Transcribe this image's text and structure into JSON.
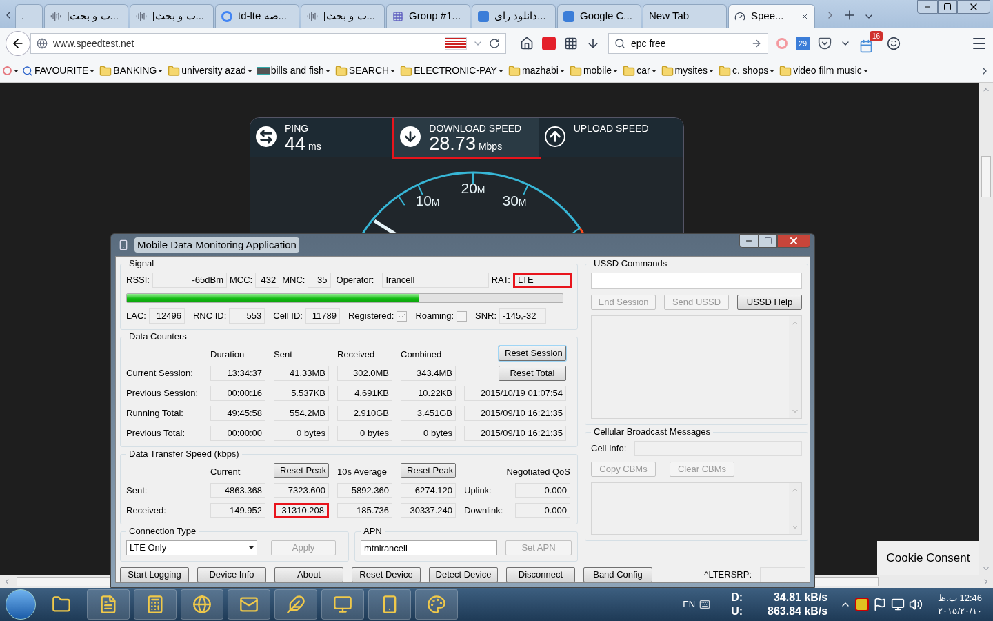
{
  "browser": {
    "tabs": [
      {
        "label": ".",
        "kind": "none",
        "selected": false
      },
      {
        "label": "[ب و بحث...",
        "kind": "audio",
        "selected": false
      },
      {
        "label": "[ب و بحث...",
        "kind": "audio",
        "selected": false
      },
      {
        "label": "td-lte صه...",
        "kind": "g",
        "selected": false
      },
      {
        "label": "[ب و بحث...",
        "kind": "audio",
        "selected": false
      },
      {
        "label": "Group #1...",
        "kind": "grid",
        "selected": false
      },
      {
        "label": "دانلود رای...",
        "kind": "s",
        "selected": false
      },
      {
        "label": "Google C...",
        "kind": "s",
        "selected": false
      },
      {
        "label": "New Tab",
        "kind": "none",
        "selected": false
      },
      {
        "label": "Spee...",
        "kind": "gauge",
        "selected": true
      }
    ],
    "url": "www.speedtest.net",
    "search": "epc free",
    "calendar_day": "29",
    "notification_count": "16",
    "bookmarks": [
      {
        "label": "FAVOURITE",
        "kind": "search"
      },
      {
        "label": "BANKING",
        "kind": "folder"
      },
      {
        "label": "university azad",
        "kind": "folder"
      },
      {
        "label": "bills and fish",
        "kind": "card"
      },
      {
        "label": "SEARCH",
        "kind": "folder"
      },
      {
        "label": "ELECTRONIC-PAY",
        "kind": "folder"
      },
      {
        "label": "mazhabi",
        "kind": "folder"
      },
      {
        "label": "mobile",
        "kind": "folder"
      },
      {
        "label": "car",
        "kind": "folder"
      },
      {
        "label": "mysites",
        "kind": "folder"
      },
      {
        "label": "c. shops",
        "kind": "folder"
      },
      {
        "label": "video film music",
        "kind": "folder"
      }
    ]
  },
  "speedtest": {
    "panels": [
      {
        "kind": "ping",
        "title": "PING",
        "value": "44",
        "unit": "ms",
        "highlighted": false
      },
      {
        "kind": "download",
        "title": "DOWNLOAD SPEED",
        "value": "28.73",
        "unit": "Mbps",
        "highlighted": true
      },
      {
        "kind": "upload",
        "title": "UPLOAD SPEED",
        "highlighted": false
      }
    ],
    "gauge_labels": [
      {
        "value": "10",
        "unit": "M"
      },
      {
        "value": "20",
        "unit": "M"
      },
      {
        "value": "30",
        "unit": "M"
      }
    ]
  },
  "cookie_button": "Cookie Consent",
  "dialog": {
    "title": "Mobile Data Monitoring Application",
    "signal": {
      "title": "Signal",
      "row1": [
        {
          "label": "RSSI:",
          "value": "-65dBm",
          "kind": "number",
          "highlighted": false
        },
        {
          "label": "MCC:",
          "value": "432",
          "kind": "number",
          "highlighted": false
        },
        {
          "label": "MNC:",
          "value": "35",
          "kind": "number",
          "highlighted": false
        },
        {
          "label": "Operator:",
          "value": "Irancell",
          "kind": "text",
          "highlighted": false
        },
        {
          "label": "RAT:",
          "value": "LTE",
          "kind": "text",
          "highlighted": true
        }
      ],
      "level": 0.67,
      "row2": [
        {
          "label": "LAC:",
          "value": "12496",
          "kind": "number"
        },
        {
          "label": "RNC ID:",
          "value": "553",
          "kind": "number"
        },
        {
          "label": "Cell ID:",
          "value": "11789",
          "kind": "number"
        },
        {
          "label": "Registered:",
          "kind": "checkbox",
          "checked": true
        },
        {
          "label": "Roaming:",
          "kind": "checkbox",
          "checked": false
        },
        {
          "label": "SNR:",
          "value": "-145,-32",
          "kind": "text"
        }
      ]
    },
    "counters": {
      "title": "Data Counters",
      "columns": [
        "Duration",
        "Sent",
        "Received",
        "Combined"
      ],
      "buttons": [
        {
          "label": "Reset Session",
          "focused": true
        },
        {
          "label": "Reset Total",
          "focused": false
        }
      ],
      "rows": [
        {
          "label": "Current Session:",
          "values": [
            "13:34:37",
            "41.33MB",
            "302.0MB",
            "343.4MB"
          ]
        },
        {
          "label": "Previous Session:",
          "values": [
            "00:00:16",
            "5.537KB",
            "4.691KB",
            "10.22KB"
          ],
          "timestamp": "2015/10/19 01:07:54"
        },
        {
          "label": "Running Total:",
          "values": [
            "49:45:58",
            "554.2MB",
            "2.910GB",
            "3.451GB"
          ],
          "timestamp": "2015/09/10 16:21:35"
        },
        {
          "label": "Previous Total:",
          "values": [
            "00:00:00",
            "0 bytes",
            "0 bytes",
            "0 bytes"
          ],
          "timestamp": "2015/09/10 16:21:35"
        }
      ]
    },
    "transfer": {
      "title": "Data Transfer Speed (kbps)",
      "current_heading": "Current",
      "average_heading": "10s Average",
      "qos_heading": "Negotiated QoS",
      "reset_buttons": [
        "Reset Peak",
        "Reset Peak"
      ],
      "rows": [
        {
          "label": "Sent:",
          "values": [
            {
              "value": "4863.368",
              "highlighted": false
            },
            {
              "value": "7323.600",
              "highlighted": false
            },
            {
              "value": "5892.360",
              "highlighted": false
            },
            {
              "value": "6274.120",
              "highlighted": false
            }
          ],
          "qos_label": "Uplink:",
          "qos_value": "0.000"
        },
        {
          "label": "Received:",
          "values": [
            {
              "value": "149.952",
              "highlighted": false
            },
            {
              "value": "31310.208",
              "highlighted": true
            },
            {
              "value": "185.736",
              "highlighted": false
            },
            {
              "value": "30337.240",
              "highlighted": false
            }
          ],
          "qos_label": "Downlink:",
          "qos_value": "0.000"
        }
      ]
    },
    "connection": {
      "title": "Connection Type",
      "selected": "LTE Only",
      "apply": {
        "label": "Apply",
        "disabled": true
      }
    },
    "apn": {
      "title": "APN",
      "value": "mtnirancell",
      "set": {
        "label": "Set APN",
        "disabled": true
      }
    },
    "ussd": {
      "title": "USSD Commands",
      "buttons": [
        {
          "label": "End Session",
          "disabled": true
        },
        {
          "label": "Send USSD",
          "disabled": true
        },
        {
          "label": "USSD Help",
          "disabled": false
        }
      ]
    },
    "cbm": {
      "title": "Cellular Broadcast Messages",
      "cell_info_label": "Cell Info:",
      "buttons": [
        {
          "label": "Copy CBMs",
          "disabled": true
        },
        {
          "label": "Clear CBMs",
          "disabled": true
        }
      ]
    },
    "bottom_buttons": [
      "Start Logging",
      "Device Info",
      "About",
      "Reset Device",
      "Detect Device",
      "Disconnect",
      "Band Config"
    ],
    "rsrp_label": "^LTERSRP:"
  },
  "taskbar": {
    "apps": [
      {
        "kind": "folder"
      },
      {
        "kind": "word"
      },
      {
        "kind": "calculator"
      },
      {
        "kind": "firefox"
      },
      {
        "kind": "outlook"
      },
      {
        "kind": "feather"
      },
      {
        "kind": "monitor"
      },
      {
        "kind": "phone"
      },
      {
        "kind": "paint"
      }
    ],
    "language": "EN",
    "download_label": "D:",
    "download": "34.81 kB/s",
    "upload_label": "U:",
    "upload": "863.84 kB/s",
    "time": "12:46 ب.ظ",
    "date": "۲۰۱۵/۲۰/۱۰"
  }
}
